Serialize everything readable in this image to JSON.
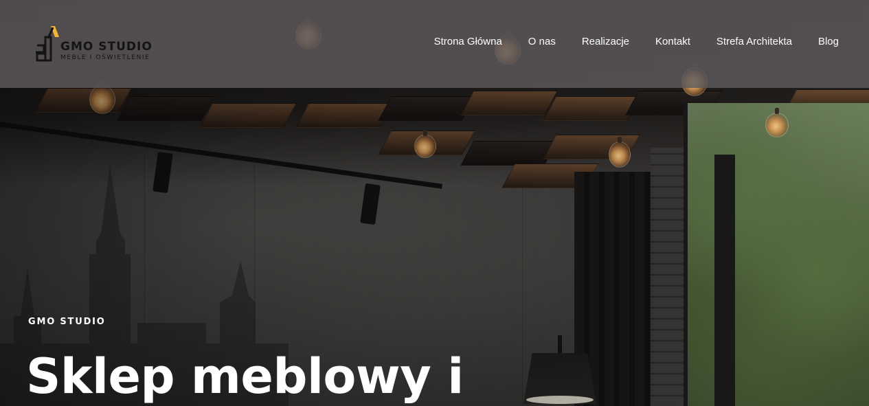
{
  "header": {
    "logo": {
      "title": "GMO STUDIO",
      "subtitle": "MEBLE I OŚWIETLENIE",
      "icon": "gmo-studio-logo-mark"
    },
    "nav": [
      {
        "label": "Strona Główna"
      },
      {
        "label": "O nas"
      },
      {
        "label": "Realizacje"
      },
      {
        "label": "Kontakt"
      },
      {
        "label": "Strefa Architekta"
      },
      {
        "label": "Blog"
      }
    ]
  },
  "hero": {
    "eyebrow": "GMO STUDIO",
    "headline": "Sklep meblowy i"
  },
  "colors": {
    "header_bg": "#5f5a5d",
    "text": "#ffffff",
    "logo_accent": "#f2b632"
  }
}
